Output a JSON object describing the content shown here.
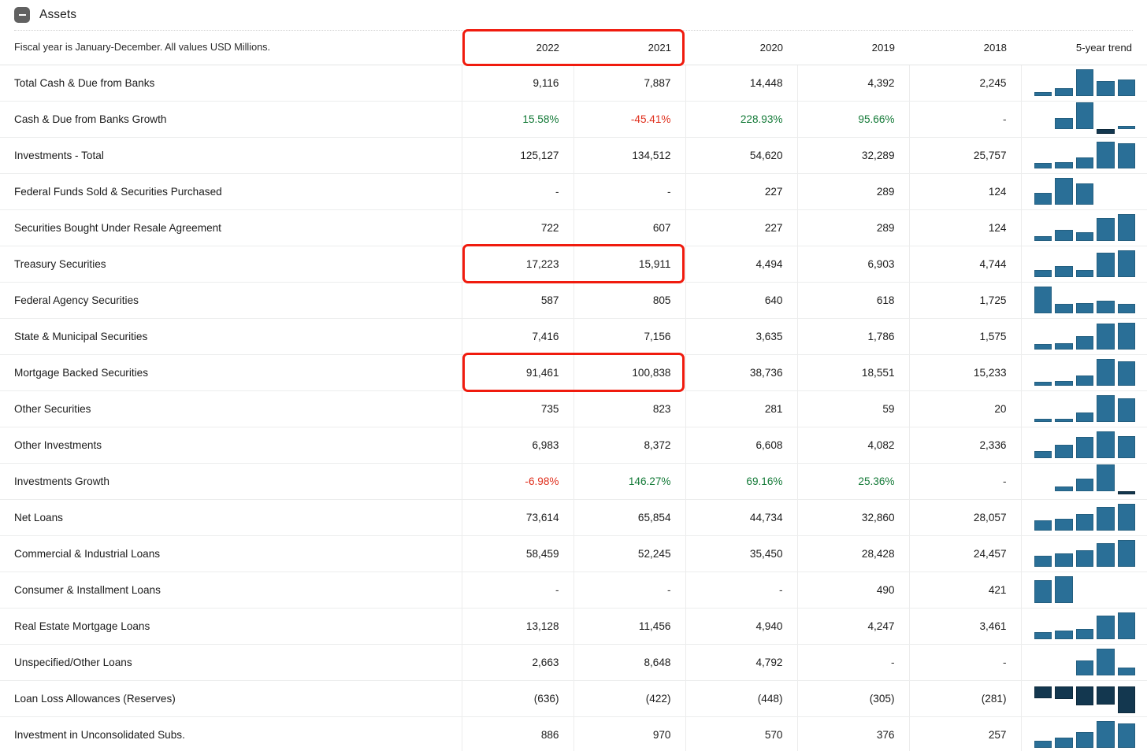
{
  "section": {
    "title": "Assets",
    "toggle_icon": "minus-collapse-icon",
    "toggle_state": "expanded"
  },
  "table": {
    "note": "Fiscal year is January-December. All values USD Millions.",
    "columns": [
      "2022",
      "2021",
      "2020",
      "2019",
      "2018"
    ],
    "trend_header": "5-year trend",
    "colors": {
      "positive": "#147a38",
      "negative": "#e0301e",
      "bar": "#2a6f97",
      "bar_negative": "#13374f",
      "highlight": "#f01b0e"
    },
    "rows": [
      {
        "label": "Total Cash & Due from Banks",
        "indent": 0,
        "values": [
          "9,116",
          "7,887",
          "14,448",
          "4,392",
          "2,245"
        ],
        "trend": [
          2245,
          4392,
          14448,
          7887,
          9116
        ]
      },
      {
        "label": "Cash & Due from Banks Growth",
        "indent": 1,
        "kind": "percent",
        "values": [
          "15.58%",
          "-45.41%",
          "228.93%",
          "95.66%",
          "-"
        ],
        "signs": [
          "pos",
          "neg",
          "pos",
          "pos",
          "none"
        ],
        "trend": [
          null,
          95.66,
          228.93,
          -45.41,
          15.58
        ]
      },
      {
        "label": "Investments - Total",
        "indent": 0,
        "values": [
          "125,127",
          "134,512",
          "54,620",
          "32,289",
          "25,757"
        ],
        "trend": [
          25757,
          32289,
          54620,
          134512,
          125127
        ]
      },
      {
        "label": "Federal Funds Sold & Securities Purchased",
        "indent": 1,
        "values": [
          "-",
          "-",
          "227",
          "289",
          "124"
        ],
        "trend": [
          124,
          289,
          227,
          null,
          null
        ]
      },
      {
        "label": "Securities Bought Under Resale Agreement",
        "indent": 2,
        "values": [
          "722",
          "607",
          "227",
          "289",
          "124"
        ],
        "trend": [
          124,
          289,
          227,
          607,
          722
        ]
      },
      {
        "label": "Treasury Securities",
        "indent": 1,
        "values": [
          "17,223",
          "15,911",
          "4,494",
          "6,903",
          "4,744"
        ],
        "trend": [
          4744,
          6903,
          4494,
          15911,
          17223
        ]
      },
      {
        "label": "Federal Agency Securities",
        "indent": 1,
        "values": [
          "587",
          "805",
          "640",
          "618",
          "1,725"
        ],
        "trend": [
          1725,
          618,
          640,
          805,
          587
        ]
      },
      {
        "label": "State & Municipal Securities",
        "indent": 1,
        "values": [
          "7,416",
          "7,156",
          "3,635",
          "1,786",
          "1,575"
        ],
        "trend": [
          1575,
          1786,
          3635,
          7156,
          7416
        ]
      },
      {
        "label": "Mortgage Backed Securities",
        "indent": 1,
        "values": [
          "91,461",
          "100,838",
          "38,736",
          "18,551",
          "15,233"
        ],
        "trend": [
          15233,
          18551,
          38736,
          100838,
          91461
        ]
      },
      {
        "label": "Other Securities",
        "indent": 1,
        "values": [
          "735",
          "823",
          "281",
          "59",
          "20"
        ],
        "trend": [
          20,
          59,
          281,
          823,
          735
        ]
      },
      {
        "label": "Other Investments",
        "indent": 1,
        "values": [
          "6,983",
          "8,372",
          "6,608",
          "4,082",
          "2,336"
        ],
        "trend": [
          2336,
          4082,
          6608,
          8372,
          6983
        ]
      },
      {
        "label": "Investments Growth",
        "indent": 1,
        "kind": "percent",
        "values": [
          "-6.98%",
          "146.27%",
          "69.16%",
          "25.36%",
          "-"
        ],
        "signs": [
          "neg",
          "pos",
          "pos",
          "pos",
          "none"
        ],
        "trend": [
          null,
          25.36,
          69.16,
          146.27,
          -6.98
        ]
      },
      {
        "label": "Net Loans",
        "indent": 0,
        "values": [
          "73,614",
          "65,854",
          "44,734",
          "32,860",
          "28,057"
        ],
        "trend": [
          28057,
          32860,
          44734,
          65854,
          73614
        ]
      },
      {
        "label": "Commercial & Industrial Loans",
        "indent": 2,
        "values": [
          "58,459",
          "52,245",
          "35,450",
          "28,428",
          "24,457"
        ],
        "trend": [
          24457,
          28428,
          35450,
          52245,
          58459
        ]
      },
      {
        "label": "Consumer & Installment Loans",
        "indent": 2,
        "values": [
          "-",
          "-",
          "-",
          "490",
          "421"
        ],
        "trend": [
          421,
          490,
          null,
          null,
          null
        ]
      },
      {
        "label": "Real Estate Mortgage Loans",
        "indent": 2,
        "values": [
          "13,128",
          "11,456",
          "4,940",
          "4,247",
          "3,461"
        ],
        "trend": [
          3461,
          4247,
          4940,
          11456,
          13128
        ]
      },
      {
        "label": "Unspecified/Other Loans",
        "indent": 2,
        "values": [
          "2,663",
          "8,648",
          "4,792",
          "-",
          "-"
        ],
        "trend": [
          null,
          null,
          4792,
          8648,
          2663
        ]
      },
      {
        "label": "Loan Loss Allowances (Reserves)",
        "indent": 1,
        "values": [
          "(636)",
          "(422)",
          "(448)",
          "(305)",
          "(281)"
        ],
        "trend": [
          -281,
          -305,
          -448,
          -422,
          -636
        ]
      },
      {
        "label": "Investment in Unconsolidated Subs.",
        "indent": 0,
        "values": [
          "886",
          "970",
          "570",
          "376",
          "257"
        ],
        "trend": [
          257,
          376,
          570,
          970,
          886
        ]
      }
    ],
    "highlights": [
      {
        "name": "header-years-highlight",
        "row": -1,
        "col_start": 0,
        "col_end": 1
      },
      {
        "name": "treasury-securities-highlight",
        "row": 5,
        "col_start": 0,
        "col_end": 1
      },
      {
        "name": "mortgage-backed-securities-highlight",
        "row": 8,
        "col_start": 0,
        "col_end": 1
      }
    ]
  }
}
